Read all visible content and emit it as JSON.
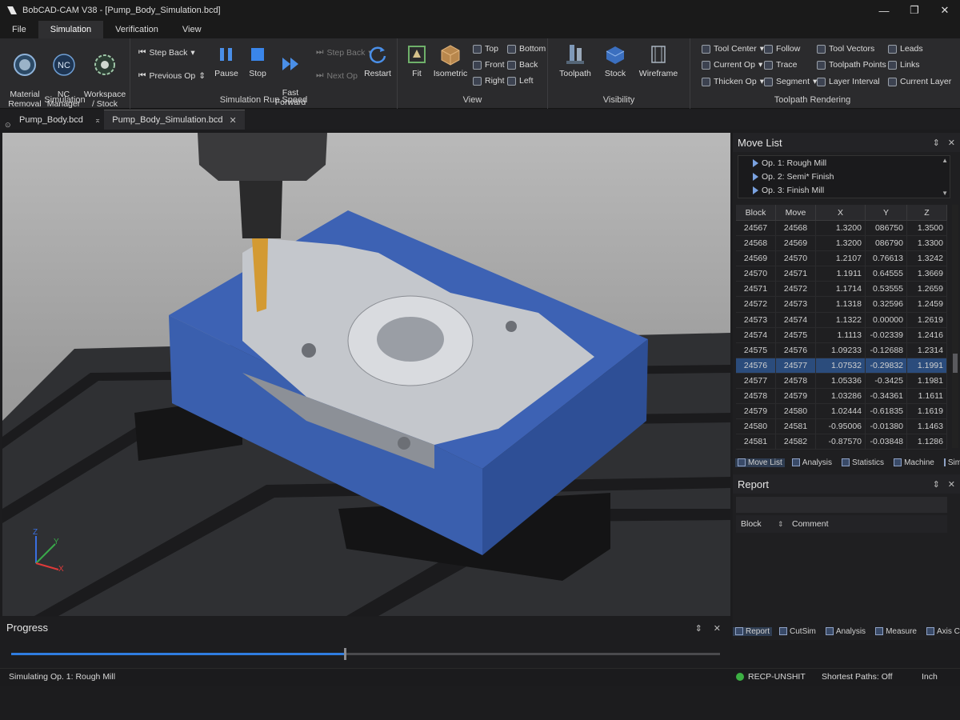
{
  "window": {
    "title": "BobCAD-CAM V38 - [Pump_Body_Simulation.bcd]"
  },
  "menu": [
    "File",
    "Simulation",
    "Verification",
    "View"
  ],
  "ribbon": {
    "simulation_group": {
      "label": "Simulation",
      "material_removal": "Material\nRemoval",
      "nc_manager": "NC\nManager",
      "nc_badge": "NC",
      "workspace_stock": "Workspace\n/ Stock"
    },
    "run_speed_group": {
      "label": "Simulation Run Speed",
      "step_back": "Step Back",
      "previous_op": "Previous Op",
      "pause": "Pause",
      "stop": "Stop",
      "fast_forward": "Fast\nForward",
      "step_back_dim": "Step Back",
      "next_op": "Next Op",
      "restart": "Restart"
    },
    "view_group": {
      "label": "View",
      "fit": "Fit",
      "isometric": "Isometric",
      "top": "Top",
      "bottom": "Bottom",
      "front": "Front",
      "back": "Back",
      "right": "Right",
      "left": "Left"
    },
    "visibility_group": {
      "label": "Visibility",
      "toolpath": "Toolpath",
      "stock": "Stock",
      "wireframe": "Wireframe"
    },
    "rendering_group": {
      "label": "Toolpath Rendering",
      "tool_center": "Tool Center",
      "follow": "Follow",
      "tool_vectors": "Tool Vectors",
      "leads": "Leads",
      "current_op": "Current Op",
      "trace": "Trace",
      "toolpath_points": "Toolpath Points",
      "links": "Links",
      "thicken_op": "Thicken Op",
      "segment": "Segment",
      "layer_interval": "Layer Interval",
      "current_layer": "Current Layer"
    }
  },
  "doc_tabs": [
    {
      "label": "Pump_Body.bcd"
    },
    {
      "label": "Pump_Body_Simulation.bcd"
    }
  ],
  "move_list": {
    "title": "Move List",
    "ops": [
      "Op. 1: Rough Mill",
      "Op. 2: Semi* Finish",
      "Op. 3: Finish Mill"
    ],
    "columns": [
      "Block",
      "Move",
      "X",
      "Y",
      "Z"
    ],
    "rows": [
      [
        "24567",
        "24568",
        "1.3200",
        "086750",
        "1.3500"
      ],
      [
        "24568",
        "24569",
        "1.3200",
        "086790",
        "1.3300"
      ],
      [
        "24569",
        "24570",
        "1.2107",
        "0.76613",
        "1.3242"
      ],
      [
        "24570",
        "24571",
        "1.1911",
        "0.64555",
        "1.3669"
      ],
      [
        "24571",
        "24572",
        "1.1714",
        "0.53555",
        "1.2659"
      ],
      [
        "24572",
        "24573",
        "1.1318",
        "0.32596",
        "1.2459"
      ],
      [
        "24573",
        "24574",
        "1.1322",
        "0.00000",
        "1.2619"
      ],
      [
        "24574",
        "24575",
        "1.1113",
        "-0.02339",
        "1.2416"
      ],
      [
        "24575",
        "24576",
        "1.09233",
        "-0.12688",
        "1.2314"
      ],
      [
        "24576",
        "24577",
        "1.07532",
        "-0.29832",
        "1.1991"
      ],
      [
        "24577",
        "24578",
        "1.05336",
        "-0.3425",
        "1.1981"
      ],
      [
        "24578",
        "24579",
        "1.03286",
        "-0.34361",
        "1.1611"
      ],
      [
        "24579",
        "24580",
        "1.02444",
        "-0.61835",
        "1.1619"
      ],
      [
        "24580",
        "24581",
        "-0.95006",
        "-0.01380",
        "1.1463"
      ],
      [
        "24581",
        "24582",
        "-0.87570",
        "-0.03848",
        "1.1286"
      ]
    ],
    "selected_row": 9,
    "tabs": [
      "Move List",
      "Analysis",
      "Statistics",
      "Machine",
      "Simulation"
    ]
  },
  "report": {
    "title": "Report",
    "columns": [
      "Block",
      "Comment"
    ],
    "tabs": [
      "Report",
      "CutSim",
      "Analysis",
      "Measure",
      "Axis Control"
    ]
  },
  "progress": {
    "title": "Progress",
    "value_percent": 47
  },
  "status": {
    "message": "Simulating Op. 1: Rough Mill",
    "connection": "RECP-UNSHIT",
    "shortest_paths": "Shortest Paths: Off",
    "units": "Inch"
  },
  "axis": {
    "z": "Z",
    "y": "Y",
    "x": "X"
  },
  "colors": {
    "stock_blue": "#3d62b4",
    "accent": "#2f7de0",
    "status_green": "#3cb043"
  }
}
